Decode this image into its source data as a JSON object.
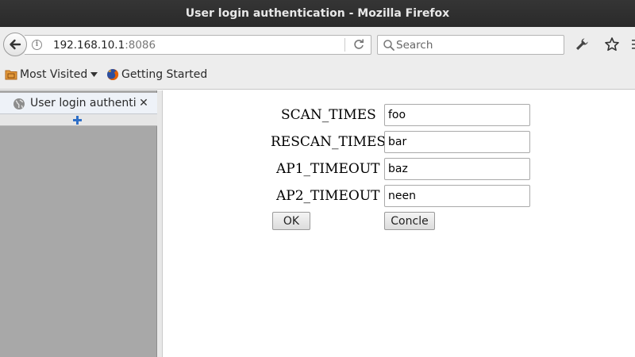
{
  "window": {
    "title": "User login authentication - Mozilla Firefox"
  },
  "navbar": {
    "url_host": "192.168.10.1",
    "url_port": ":8086",
    "search_placeholder": "Search"
  },
  "bookmarks": {
    "most_visited": "Most Visited",
    "getting_started": "Getting Started"
  },
  "tab": {
    "label": "User login authentication"
  },
  "form": {
    "fields": [
      {
        "label": "SCAN_TIMES",
        "value": "foo"
      },
      {
        "label": "RESCAN_TIMES",
        "value": "bar"
      },
      {
        "label": "AP1_TIMEOUT",
        "value": "baz"
      },
      {
        "label": "AP2_TIMEOUT",
        "value": "neen"
      }
    ],
    "ok_label": "OK",
    "cancel_label": "Concle"
  },
  "colors": {
    "firefox_orange": "#e66000",
    "newtab_blue": "#2f6fc7"
  }
}
